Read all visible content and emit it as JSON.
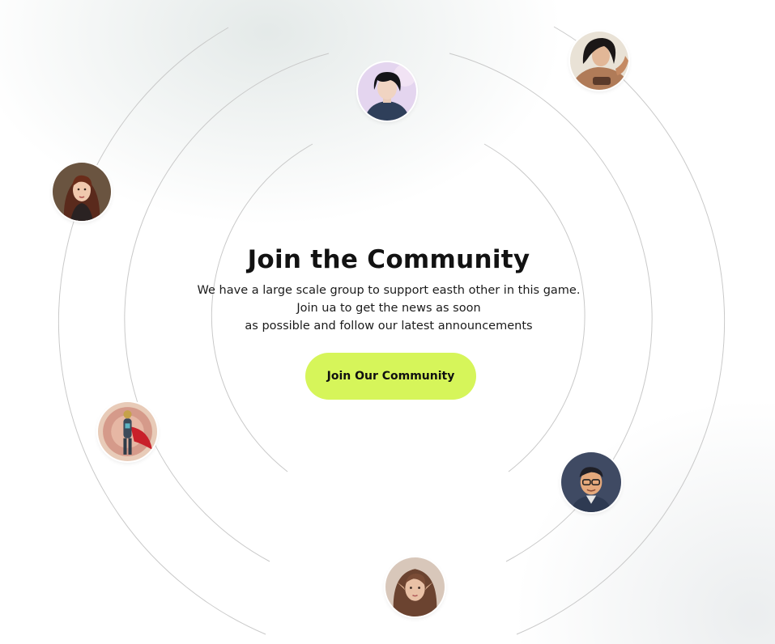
{
  "community": {
    "title": "Join the Community",
    "description_lines": [
      "We have a large scale group to support easth other in this game.",
      "Join ua to get the news as soon",
      "as possible and follow our latest announcements"
    ],
    "cta_label": "Join Our Community"
  },
  "colors": {
    "cta_background": "#d6f55a",
    "ring_stroke": "#c9c9c9",
    "title_text": "#121212"
  },
  "avatars": [
    {
      "name": "avatar-anime-boy"
    },
    {
      "name": "avatar-warrior-woman"
    },
    {
      "name": "avatar-red-haired-woman"
    },
    {
      "name": "avatar-armored-hero"
    },
    {
      "name": "avatar-cartoon-man-glasses"
    },
    {
      "name": "avatar-elf-woman"
    }
  ]
}
